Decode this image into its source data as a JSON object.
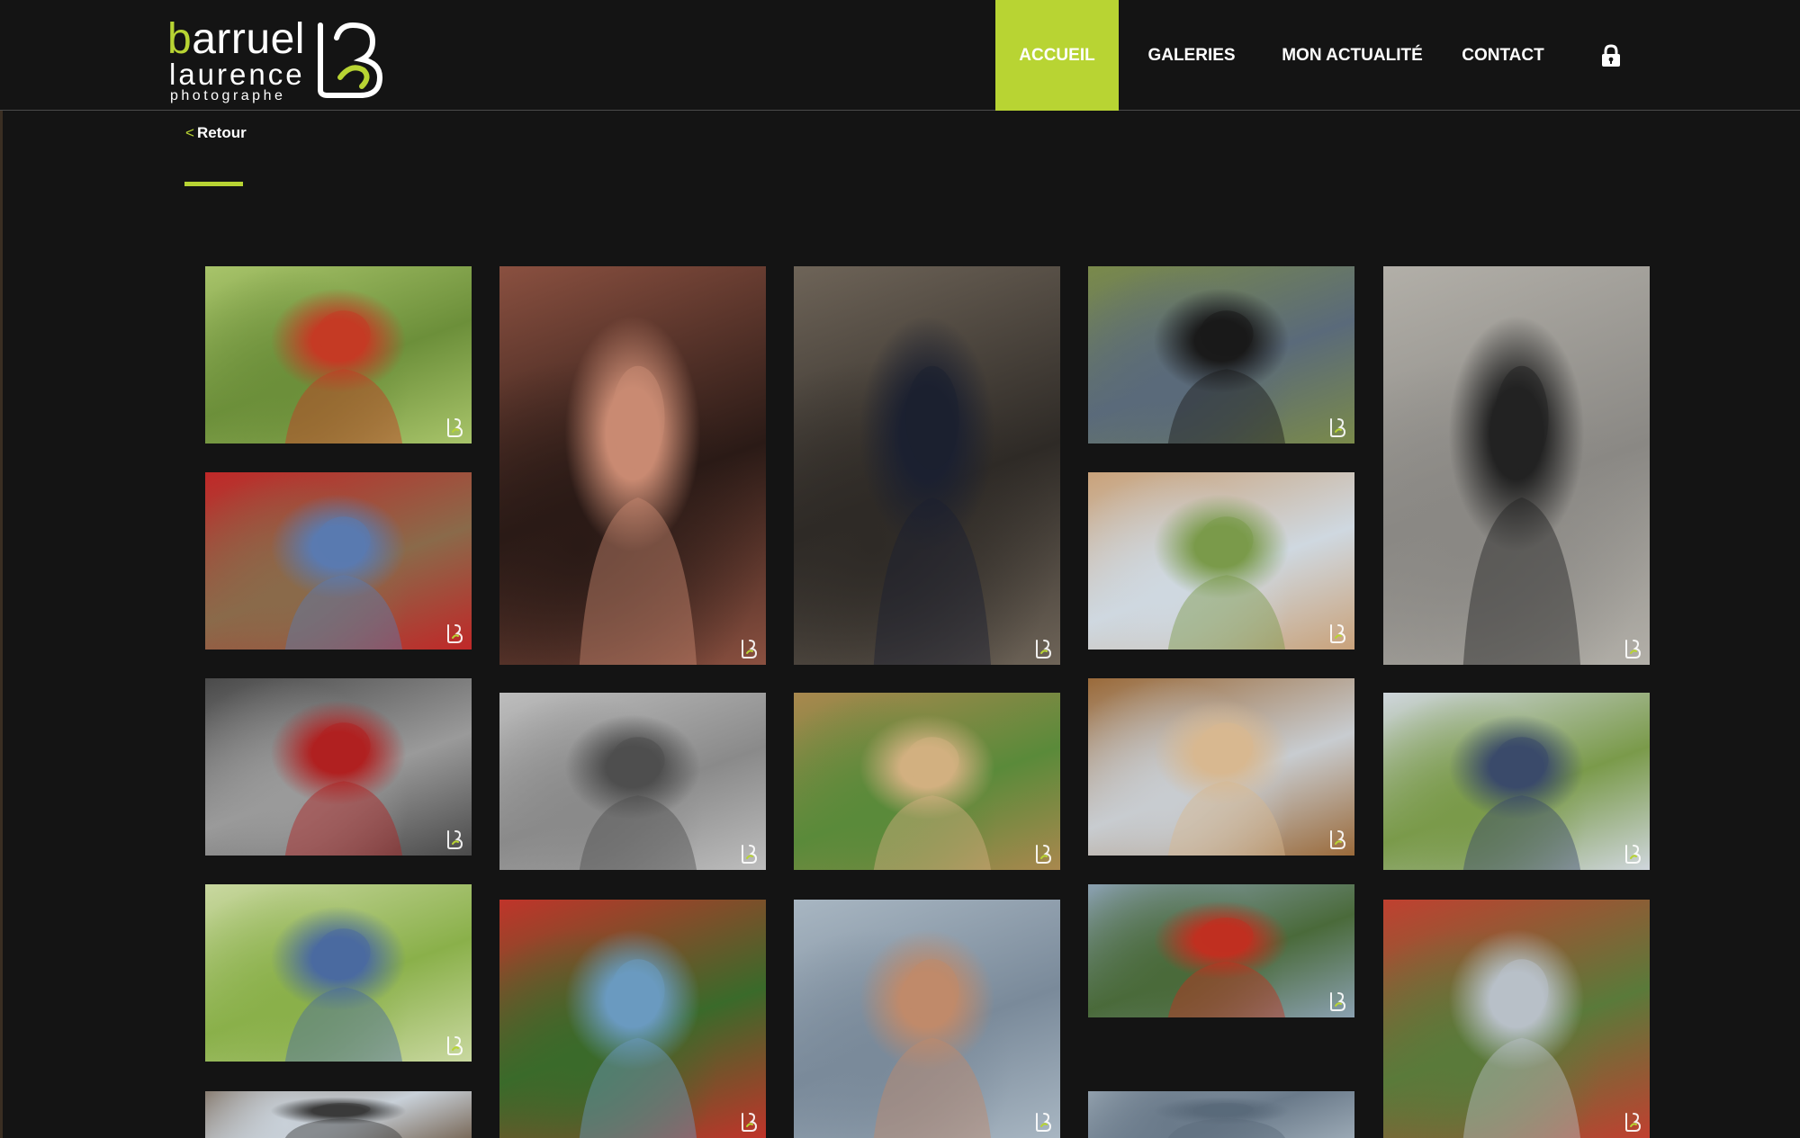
{
  "logo": {
    "name_first": "b",
    "name_rest": "arruel",
    "line2": "laurence",
    "line3": "photographe"
  },
  "nav": {
    "items": [
      {
        "label": "ACCUEIL",
        "active": true
      },
      {
        "label": "GALERIES",
        "active": false
      },
      {
        "label": "MON ACTUALITÉ",
        "active": false
      },
      {
        "label": "CONTACT",
        "active": false
      }
    ],
    "lock_icon": "lock-icon"
  },
  "back": {
    "chevron": "<",
    "label": "Retour"
  },
  "colors": {
    "accent": "#b8d433",
    "background": "#141414",
    "text": "#ffffff"
  },
  "gallery": {
    "photos": [
      {
        "subject": "girl-with-poppies",
        "palette": [
          "#6c8f3a",
          "#a8c46a",
          "#c53a24"
        ]
      },
      {
        "subject": "girl-portrait-dark",
        "palette": [
          "#2a1a16",
          "#8a5040",
          "#c98a72"
        ]
      },
      {
        "subject": "cloister-columns-woman",
        "palette": [
          "#2e2a26",
          "#6e6458",
          "#1b2030"
        ]
      },
      {
        "subject": "man-graffiti-wall",
        "palette": [
          "#5a6a7a",
          "#7a8a4a",
          "#1a1a1a"
        ]
      },
      {
        "subject": "man-wooden-door",
        "palette": [
          "#8a8884",
          "#b2afa8",
          "#222222"
        ]
      },
      {
        "subject": "two-men-barn",
        "palette": [
          "#8a6a4a",
          "#c02828",
          "#5a7ab0"
        ]
      },
      {
        "subject": "woman-laughing-field",
        "palette": [
          "#cfd8e0",
          "#c9a27a",
          "#7a9a4a"
        ]
      },
      {
        "subject": "children-poppy-field-bw",
        "palette": [
          "#9a9a9a",
          "#4a4a4a",
          "#b02020"
        ]
      },
      {
        "subject": "three-girls-bw",
        "palette": [
          "#8a8a8a",
          "#bdbdbd",
          "#4e4e4e"
        ]
      },
      {
        "subject": "woman-straw-hat-eyes-closed",
        "palette": [
          "#5a8a3a",
          "#a9884e",
          "#d2b080"
        ]
      },
      {
        "subject": "woman-straw-hat-smiling",
        "palette": [
          "#c8ccd0",
          "#9a6a3a",
          "#d8b890"
        ]
      },
      {
        "subject": "girl-umbrella-field",
        "palette": [
          "#7a9a4a",
          "#cfd6dc",
          "#3a4a6a"
        ]
      },
      {
        "subject": "girl-arms-raised",
        "palette": [
          "#8ab04a",
          "#c9d8a0",
          "#4a6aa0"
        ]
      },
      {
        "subject": "girl-back-poppies",
        "palette": [
          "#3a6a2a",
          "#c0342a",
          "#6a9ac0"
        ]
      },
      {
        "subject": "boy-shading-eyes",
        "palette": [
          "#7a8a9a",
          "#a8b6c2",
          "#c08a6a"
        ]
      },
      {
        "subject": "girl-in-poppy-field",
        "palette": [
          "#4a6a3a",
          "#8aa0b0",
          "#c03020"
        ]
      },
      {
        "subject": "boy-and-girl-field",
        "palette": [
          "#5a7a3a",
          "#c04030",
          "#b8c0c8"
        ]
      },
      {
        "subject": "child-partial-bottom-left",
        "palette": [
          "#c8d0d8",
          "#7a6a5a",
          "#3a3a3a"
        ]
      },
      {
        "subject": "landscape-partial-bottom",
        "palette": [
          "#6a7a8a",
          "#9aa8b4",
          "#5a6a7a"
        ]
      }
    ],
    "watermark_icon": "watermark-b-icon"
  }
}
